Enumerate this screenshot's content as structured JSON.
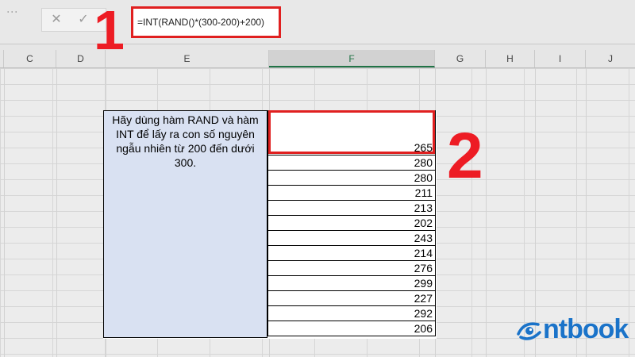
{
  "formula_bar": {
    "formula": "=INT(RAND()*(300-200)+200)",
    "cancel_icon": "x-icon",
    "enter_icon": "check-icon"
  },
  "columns": [
    {
      "label": "C",
      "left": 0
    },
    {
      "label": "D",
      "left": 0
    },
    {
      "label": "E",
      "left": 0
    },
    {
      "label": "F",
      "left": 0
    },
    {
      "label": "G",
      "left": 0
    },
    {
      "label": "H",
      "left": 0
    },
    {
      "label": "I",
      "left": 0
    },
    {
      "label": "J",
      "left": 0
    }
  ],
  "description": "Hãy dùng hàm RAND và hàm INT để lấy ra con số nguyên ngẫu nhiên từ 200 đến dưới 300.",
  "values": [
    "265",
    "280",
    "280",
    "211",
    "213",
    "202",
    "243",
    "214",
    "276",
    "299",
    "227",
    "292",
    "206"
  ],
  "annotations": {
    "step1": "1",
    "step2": "2"
  },
  "logo": {
    "text": "ntbook"
  },
  "colors": {
    "accent_red": "#e02020",
    "selected_col": "#217346",
    "desc_fill": "#d9e1f2",
    "logo_blue": "#1a73c9"
  }
}
